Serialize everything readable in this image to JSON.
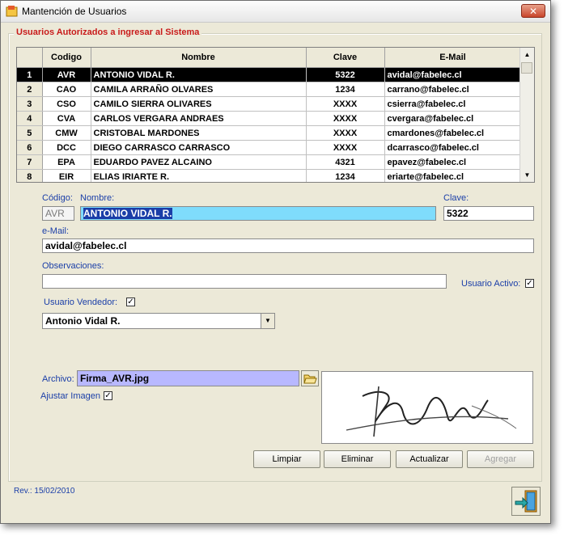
{
  "window": {
    "title": "Mantención de Usuarios",
    "close_glyph": "✕"
  },
  "group": {
    "legend": "Usuarios Autorizados a ingresar al Sistema"
  },
  "table": {
    "headers": [
      "Codigo",
      "Nombre",
      "Clave",
      "E-Mail"
    ],
    "rows": [
      {
        "num": "1",
        "codigo": "AVR",
        "nombre": "ANTONIO VIDAL R.",
        "clave": "5322",
        "email": "avidal@fabelec.cl"
      },
      {
        "num": "2",
        "codigo": "CAO",
        "nombre": "CAMILA ARRAÑO OLVARES",
        "clave": "1234",
        "email": "carrano@fabelec.cl"
      },
      {
        "num": "3",
        "codigo": "CSO",
        "nombre": "CAMILO SIERRA OLIVARES",
        "clave": "XXXX",
        "email": "csierra@fabelec.cl"
      },
      {
        "num": "4",
        "codigo": "CVA",
        "nombre": "CARLOS VERGARA ANDRAES",
        "clave": "XXXX",
        "email": "cvergara@fabelec.cl"
      },
      {
        "num": "5",
        "codigo": "CMW",
        "nombre": "CRISTOBAL MARDONES",
        "clave": "XXXX",
        "email": "cmardones@fabelec.cl"
      },
      {
        "num": "6",
        "codigo": "DCC",
        "nombre": "DIEGO CARRASCO CARRASCO",
        "clave": "XXXX",
        "email": "dcarrasco@fabelec.cl"
      },
      {
        "num": "7",
        "codigo": "EPA",
        "nombre": "EDUARDO PAVEZ ALCAINO",
        "clave": "4321",
        "email": "epavez@fabelec.cl"
      },
      {
        "num": "8",
        "codigo": "EIR",
        "nombre": "ELIAS IRIARTE R.",
        "clave": "1234",
        "email": "eriarte@fabelec.cl"
      }
    ]
  },
  "form": {
    "codigo_label": "Código:",
    "codigo_value": "AVR",
    "nombre_label": "Nombre:",
    "nombre_value": "ANTONIO VIDAL R.",
    "clave_label": "Clave:",
    "clave_value": "5322",
    "email_label": "e-Mail:",
    "email_value": "avidal@fabelec.cl",
    "obs_label": "Observaciones:",
    "obs_value": "",
    "activo_label": "Usuario Activo:",
    "activo_checked": true,
    "vendedor_label": "Usuario Vendedor:",
    "vendedor_checked": true,
    "vendedor_select": "Antonio Vidal R.",
    "archivo_label": "Archivo:",
    "archivo_value": "Firma_AVR.jpg",
    "ajustar_label": "Ajustar Imagen",
    "ajustar_checked": true
  },
  "buttons": {
    "limpiar": "Limpiar",
    "eliminar": "Eliminar",
    "actualizar": "Actualizar",
    "agregar": "Agregar"
  },
  "footer": {
    "rev": "Rev.: 15/02/2010"
  },
  "colors": {
    "accent_label": "#1a3ea8",
    "legend": "#c81a1a",
    "selected_field": "#7fdcfc",
    "file_field": "#b8b8ff"
  }
}
